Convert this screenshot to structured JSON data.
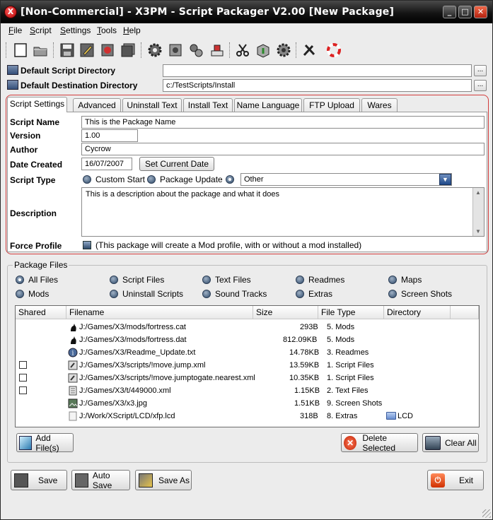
{
  "window": {
    "title": "[Non-Commercial] - X3PM - Script Packager V2.00 [New Package]",
    "app_icon_glyph": "X"
  },
  "menu": [
    {
      "label": "File",
      "hot": "F",
      "rest": "ile"
    },
    {
      "label": "Script",
      "hot": "S",
      "rest": "cript"
    },
    {
      "label": "Settings",
      "hot": "S",
      "rest": "ettings"
    },
    {
      "label": "Tools",
      "hot": "T",
      "rest": "ools"
    },
    {
      "label": "Help",
      "hot": "H",
      "rest": "elp"
    }
  ],
  "toolbar_icons": [
    "new-icon",
    "open-icon",
    "save-icon",
    "save-as-icon",
    "revert-icon",
    "save-all-icon",
    "gear-icon",
    "gear-package-icon",
    "gears-icon",
    "install-icon",
    "cut-icon",
    "package-icon",
    "settings-gear-icon",
    "tools-icon",
    "help-lifebuoy-icon"
  ],
  "directories": {
    "script_label": "Default Script Directory",
    "script_value": "",
    "dest_label": "Default Destination Directory",
    "dest_value": "c:/TestScripts/Install",
    "browse_label": "..."
  },
  "tabs": [
    "Script Settings",
    "Advanced",
    "Uninstall Text",
    "Install Text",
    "Name Language",
    "FTP Upload",
    "Wares"
  ],
  "active_tab": "Script Settings",
  "settings": {
    "script_name_label": "Script Name",
    "script_name": "This is the Package Name",
    "version_label": "Version",
    "version": "1.00",
    "author_label": "Author",
    "author": "Cycrow",
    "date_label": "Date Created",
    "date": "16/07/2007",
    "set_date_button": "Set Current Date",
    "type_label": "Script Type",
    "type_options": [
      "Custom Start",
      "Package Update"
    ],
    "type_selected": "Other",
    "description_label": "Description",
    "description": "This is a description about the package and what it does",
    "force_profile_label": "Force Profile",
    "force_profile_text": "(This package will create a Mod profile, with or without a mod installed)"
  },
  "package_files": {
    "group_title": "Package Files",
    "filters": [
      "All Files",
      "Script Files",
      "Text Files",
      "Readmes",
      "Maps",
      "Mods",
      "Uninstall Scripts",
      "Sound Tracks",
      "Extras",
      "Screen Shots"
    ],
    "filter_selected": "All Files",
    "columns": [
      "Shared",
      "Filename",
      "Size",
      "File Type",
      "Directory"
    ],
    "rows": [
      {
        "shared": null,
        "icon": "cat-file-icon",
        "filename": "J:/Games/X3/mods/fortress.cat",
        "size": "293B",
        "type": "5. Mods",
        "directory": ""
      },
      {
        "shared": null,
        "icon": "dat-file-icon",
        "filename": "J:/Games/X3/mods/fortress.dat",
        "size": "812.09KB",
        "type": "5. Mods",
        "directory": ""
      },
      {
        "shared": null,
        "icon": "readme-file-icon",
        "filename": "J:/Games/X3/Readme_Update.txt",
        "size": "14.78KB",
        "type": "3. Readmes",
        "directory": ""
      },
      {
        "shared": false,
        "icon": "script-file-icon",
        "filename": "J:/Games/X3/scripts/!move.jump.xml",
        "size": "13.59KB",
        "type": "1. Script Files",
        "directory": ""
      },
      {
        "shared": false,
        "icon": "script-file-icon",
        "filename": "J:/Games/X3/scripts/!move.jumptogate.nearest.xml",
        "size": "10.35KB",
        "type": "1. Script Files",
        "directory": ""
      },
      {
        "shared": false,
        "icon": "text-file-icon",
        "filename": "J:/Games/X3/t/449000.xml",
        "size": "1.15KB",
        "type": "2. Text Files",
        "directory": ""
      },
      {
        "shared": null,
        "icon": "image-file-icon",
        "filename": "J:/Games/X3/x3.jpg",
        "size": "1.51KB",
        "type": "9. Screen Shots",
        "directory": ""
      },
      {
        "shared": null,
        "icon": "extra-file-icon",
        "filename": "J:/Work/XScript/LCD/xfp.lcd",
        "size": "318B",
        "type": "8. Extras",
        "directory": "LCD"
      }
    ],
    "add_button": "Add File(s)",
    "delete_button": "Delete Selected",
    "clear_button": "Clear All"
  },
  "bottom": {
    "save": "Save",
    "auto_save": "Auto Save",
    "save_as": "Save As",
    "exit": "Exit"
  }
}
